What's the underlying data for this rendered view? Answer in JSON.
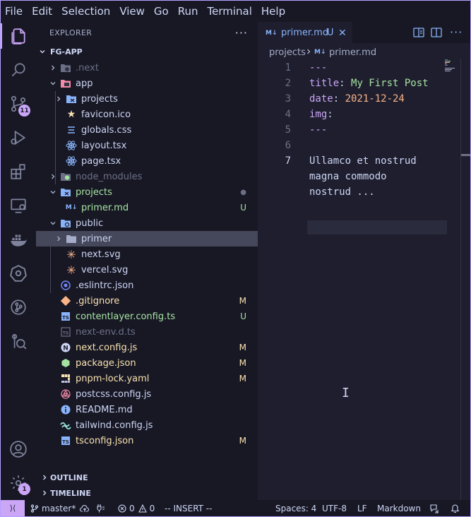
{
  "menu": [
    "File",
    "Edit",
    "Selection",
    "View",
    "Go",
    "Run",
    "Terminal",
    "Help"
  ],
  "activity": {
    "source_control_badge": "11",
    "accounts_manage_badge": "1"
  },
  "sidebar": {
    "title": "EXPLORER",
    "more_label": "···",
    "project": "FG-APP",
    "tree": [
      {
        "name": ".next",
        "status": ""
      },
      {
        "name": "app",
        "status": ""
      },
      {
        "name": "projects",
        "status": ""
      },
      {
        "name": "favicon.ico",
        "status": ""
      },
      {
        "name": "globals.css",
        "status": ""
      },
      {
        "name": "layout.tsx",
        "status": ""
      },
      {
        "name": "page.tsx",
        "status": ""
      },
      {
        "name": "node_modules",
        "status": ""
      },
      {
        "name": "projects",
        "status": "●"
      },
      {
        "name": "primer.md",
        "status": "U"
      },
      {
        "name": "public",
        "status": ""
      },
      {
        "name": "primer",
        "status": ""
      },
      {
        "name": "next.svg",
        "status": ""
      },
      {
        "name": "vercel.svg",
        "status": ""
      },
      {
        "name": ".eslintrc.json",
        "status": ""
      },
      {
        "name": ".gitignore",
        "status": "M"
      },
      {
        "name": "contentlayer.config.ts",
        "status": "U"
      },
      {
        "name": "next-env.d.ts",
        "status": ""
      },
      {
        "name": "next.config.js",
        "status": "M"
      },
      {
        "name": "package.json",
        "status": "M"
      },
      {
        "name": "pnpm-lock.yaml",
        "status": "M"
      },
      {
        "name": "postcss.config.js",
        "status": ""
      },
      {
        "name": "README.md",
        "status": ""
      },
      {
        "name": "tailwind.config.js",
        "status": ""
      },
      {
        "name": "tsconfig.json",
        "status": "M"
      }
    ],
    "outline": "OUTLINE",
    "timeline": "TIMELINE"
  },
  "editor": {
    "tab": {
      "icon": "M↓",
      "name": "primer.md",
      "status": "U",
      "close": "✕"
    },
    "breadcrumb": {
      "folder": "projects",
      "icon": "M↓",
      "file": "primer.md"
    },
    "lines": [
      {
        "n": "1",
        "a": "---",
        "b": "",
        "c": ""
      },
      {
        "n": "2",
        "a": "title",
        "b": ": ",
        "c": "My First Post"
      },
      {
        "n": "3",
        "a": "date",
        "b": ": ",
        "c": "2021-12-24"
      },
      {
        "n": "4",
        "a": "img",
        "b": ":",
        "c": ""
      },
      {
        "n": "5",
        "a": "---",
        "b": "",
        "c": ""
      },
      {
        "n": "6",
        "a": "",
        "b": "",
        "c": ""
      },
      {
        "n": "7",
        "a": "Ullamco et nostrud",
        "b": "",
        "c": ""
      }
    ],
    "wrap_lines": [
      "magna commodo",
      "nostrud ..."
    ]
  },
  "statusbar": {
    "remote_icon": "⟩⟨",
    "branch": "master*",
    "errors": "0",
    "warnings": "0",
    "mode": "-- INSERT --",
    "spaces": "Spaces: 4",
    "encoding": "UTF-8",
    "eol": "LF",
    "language": "Markdown"
  },
  "colors": {
    "accent": "#cba6f7",
    "background": "#1e1e2e",
    "sidebar": "#181825",
    "modified": "#f9e2af",
    "untracked": "#a6e3a1",
    "link": "#89b4fa"
  }
}
